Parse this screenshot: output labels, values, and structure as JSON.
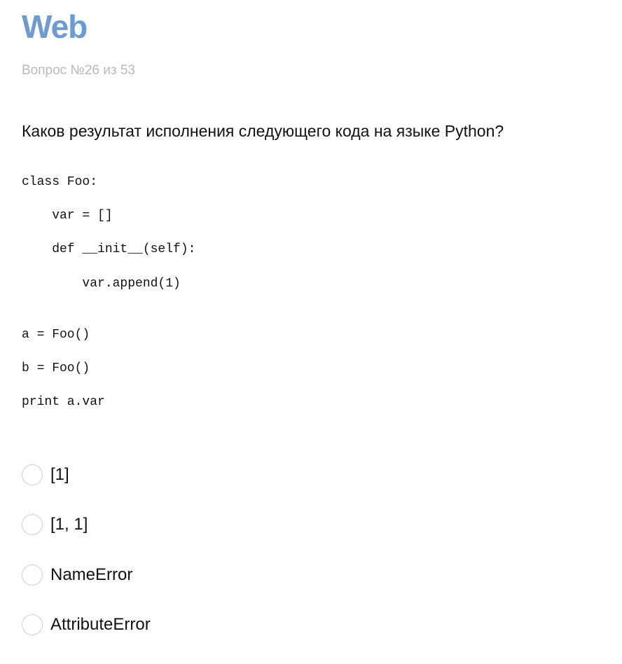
{
  "header": {
    "title": "Web",
    "title_color": "#6b9bd2",
    "question_counter": "Вопрос №26 из 53"
  },
  "question": {
    "text": "Каков результат исполнения следующего кода на языке Python?",
    "code_lines": [
      "class Foo:",
      "    var = []",
      "    def __init__(self):",
      "        var.append(1)",
      "a = Foo()",
      "b = Foo()",
      "print a.var"
    ]
  },
  "answers": {
    "options": [
      {
        "label": "[1]",
        "selected": false
      },
      {
        "label": "[1, 1]",
        "selected": false
      },
      {
        "label": "NameError",
        "selected": false
      },
      {
        "label": "AttributeError",
        "selected": false
      }
    ]
  }
}
